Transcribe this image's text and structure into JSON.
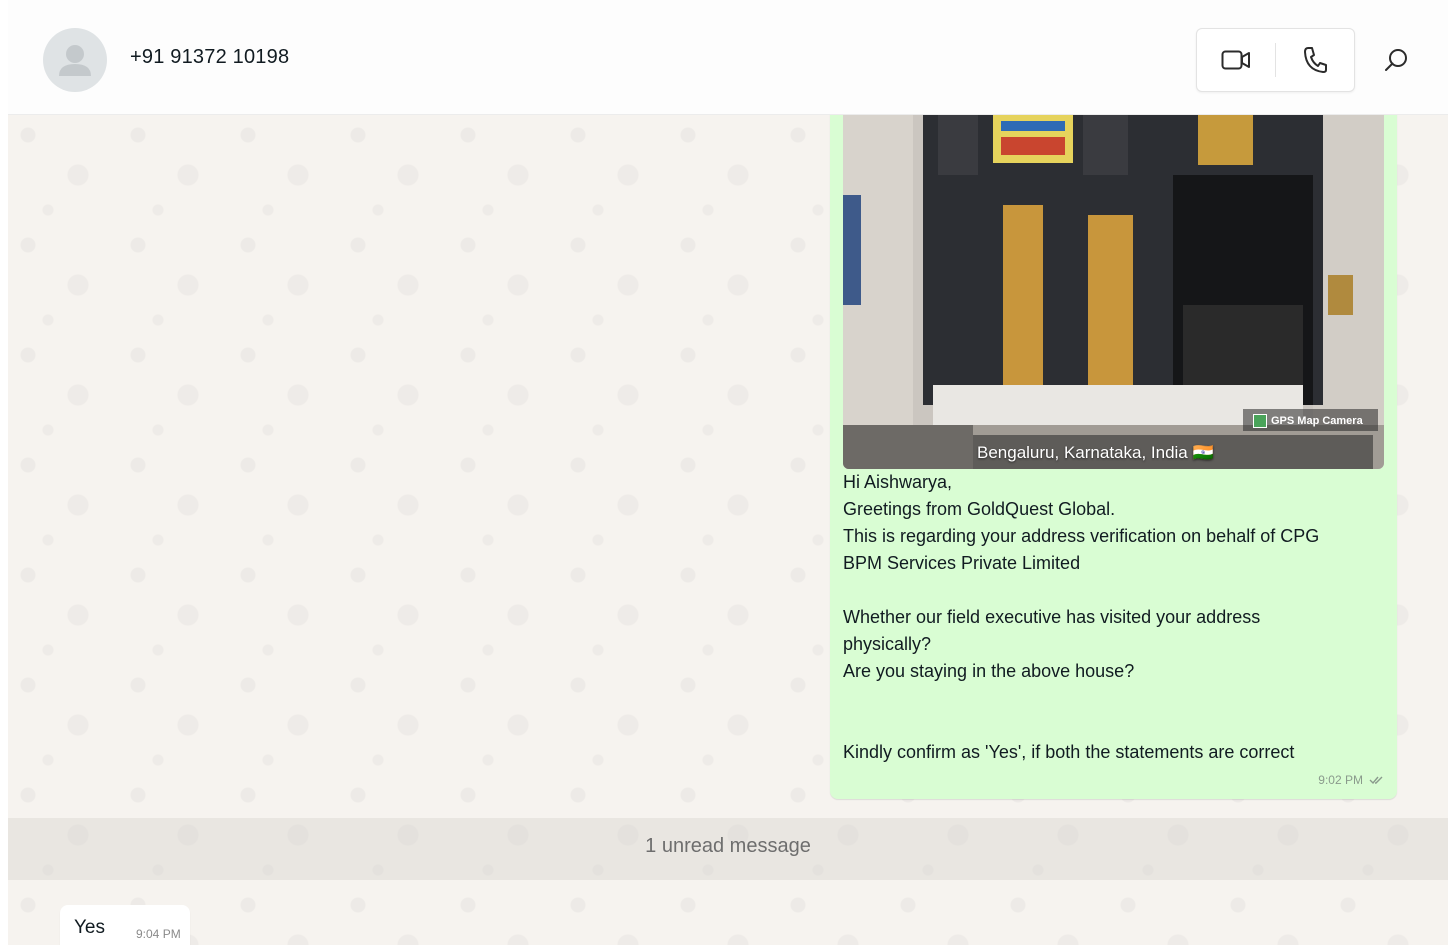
{
  "header": {
    "contact_name": "+91 91372 10198",
    "icons": {
      "avatar": "person-avatar-icon",
      "video": "video-camera-icon",
      "voice": "phone-icon",
      "search": "search-icon"
    }
  },
  "conversation": {
    "outgoing": {
      "photo": {
        "location": "Bengaluru, Karnataka, India 🇮🇳",
        "watermark": "GPS Map Camera"
      },
      "lines": [
        "Hi Aishwarya,",
        "Greetings from GoldQuest Global.",
        "This is regarding your address verification on behalf of CPG",
        "BPM Services Private Limited",
        "",
        "Whether our field executive has visited your address",
        "physically?",
        "Are you staying in the above house?",
        "",
        "",
        "Kindly confirm as 'Yes', if both the statements are correct"
      ],
      "time": "9:02 PM",
      "status_icon": "double-check-icon"
    },
    "unread_separator": "1 unread message",
    "incoming": {
      "text": "Yes",
      "time": "9:04 PM"
    }
  },
  "colors": {
    "outgoing_bubble": "#d9fdd3",
    "incoming_bubble": "#ffffff",
    "chat_background": "#f6f3ef",
    "header_background": "#fdfdfd"
  }
}
